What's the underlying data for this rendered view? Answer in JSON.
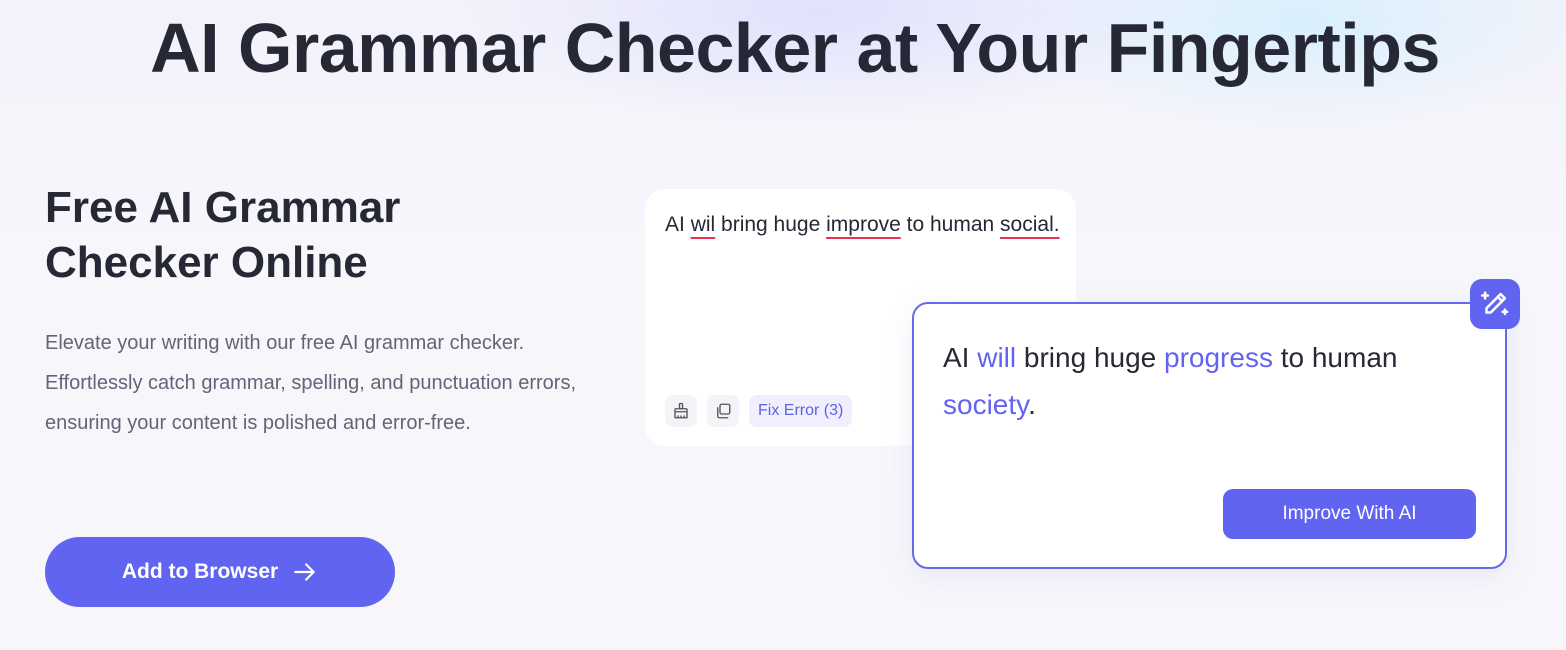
{
  "hero": {
    "title": "AI Grammar Checker at Your Fingertips"
  },
  "intro": {
    "subtitle_line1": "Free AI Grammar",
    "subtitle_line2": "Checker Online",
    "description": "Elevate your writing with our free AI grammar checker. Effortlessly catch grammar, spelling, and punctuation errors, ensuring your content is polished and error-free.",
    "cta_label": "Add to Browser"
  },
  "input_card": {
    "segments": [
      {
        "text": "AI ",
        "error": false
      },
      {
        "text": "wil",
        "error": true
      },
      {
        "text": " bring huge ",
        "error": false
      },
      {
        "text": "improve",
        "error": true
      },
      {
        "text": " to human ",
        "error": false
      },
      {
        "text": "social.",
        "error": true
      }
    ],
    "fix_label": "Fix Error (3)",
    "tool_icons": [
      "brush-icon",
      "copy-icon"
    ]
  },
  "result_card": {
    "segments": [
      {
        "text": "AI ",
        "fixed": false
      },
      {
        "text": "will",
        "fixed": true
      },
      {
        "text": " bring huge ",
        "fixed": false
      },
      {
        "text": "progress",
        "fixed": true
      },
      {
        "text": " to human ",
        "fixed": false
      },
      {
        "text": "society",
        "fixed": true
      },
      {
        "text": ".",
        "fixed": false
      }
    ],
    "improve_label": "Improve With AI",
    "badge_icon": "magic-pen-icon"
  },
  "colors": {
    "accent": "#6064f0",
    "error_underline": "#e8344e",
    "text": "#262835",
    "muted": "#636477"
  }
}
